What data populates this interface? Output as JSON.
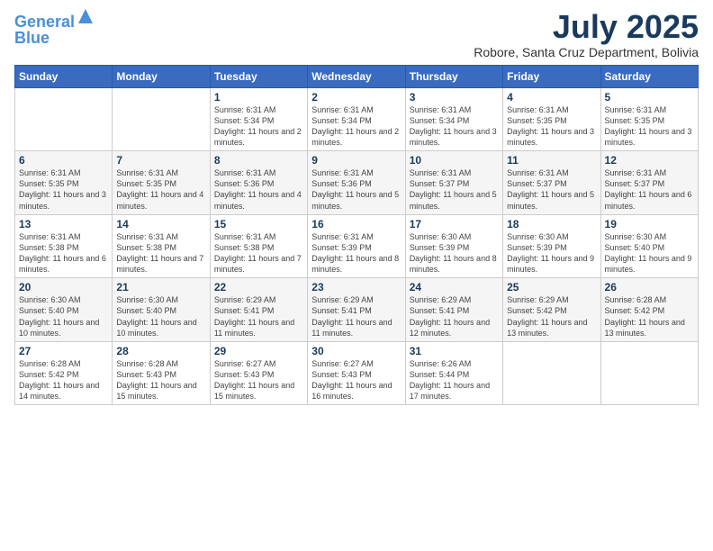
{
  "header": {
    "logo_line1": "General",
    "logo_line2": "Blue",
    "month_title": "July 2025",
    "location": "Robore, Santa Cruz Department, Bolivia"
  },
  "weekdays": [
    "Sunday",
    "Monday",
    "Tuesday",
    "Wednesday",
    "Thursday",
    "Friday",
    "Saturday"
  ],
  "weeks": [
    [
      {
        "day": "",
        "info": ""
      },
      {
        "day": "",
        "info": ""
      },
      {
        "day": "1",
        "info": "Sunrise: 6:31 AM\nSunset: 5:34 PM\nDaylight: 11 hours and 2 minutes."
      },
      {
        "day": "2",
        "info": "Sunrise: 6:31 AM\nSunset: 5:34 PM\nDaylight: 11 hours and 2 minutes."
      },
      {
        "day": "3",
        "info": "Sunrise: 6:31 AM\nSunset: 5:34 PM\nDaylight: 11 hours and 3 minutes."
      },
      {
        "day": "4",
        "info": "Sunrise: 6:31 AM\nSunset: 5:35 PM\nDaylight: 11 hours and 3 minutes."
      },
      {
        "day": "5",
        "info": "Sunrise: 6:31 AM\nSunset: 5:35 PM\nDaylight: 11 hours and 3 minutes."
      }
    ],
    [
      {
        "day": "6",
        "info": "Sunrise: 6:31 AM\nSunset: 5:35 PM\nDaylight: 11 hours and 3 minutes."
      },
      {
        "day": "7",
        "info": "Sunrise: 6:31 AM\nSunset: 5:35 PM\nDaylight: 11 hours and 4 minutes."
      },
      {
        "day": "8",
        "info": "Sunrise: 6:31 AM\nSunset: 5:36 PM\nDaylight: 11 hours and 4 minutes."
      },
      {
        "day": "9",
        "info": "Sunrise: 6:31 AM\nSunset: 5:36 PM\nDaylight: 11 hours and 5 minutes."
      },
      {
        "day": "10",
        "info": "Sunrise: 6:31 AM\nSunset: 5:37 PM\nDaylight: 11 hours and 5 minutes."
      },
      {
        "day": "11",
        "info": "Sunrise: 6:31 AM\nSunset: 5:37 PM\nDaylight: 11 hours and 5 minutes."
      },
      {
        "day": "12",
        "info": "Sunrise: 6:31 AM\nSunset: 5:37 PM\nDaylight: 11 hours and 6 minutes."
      }
    ],
    [
      {
        "day": "13",
        "info": "Sunrise: 6:31 AM\nSunset: 5:38 PM\nDaylight: 11 hours and 6 minutes."
      },
      {
        "day": "14",
        "info": "Sunrise: 6:31 AM\nSunset: 5:38 PM\nDaylight: 11 hours and 7 minutes."
      },
      {
        "day": "15",
        "info": "Sunrise: 6:31 AM\nSunset: 5:38 PM\nDaylight: 11 hours and 7 minutes."
      },
      {
        "day": "16",
        "info": "Sunrise: 6:31 AM\nSunset: 5:39 PM\nDaylight: 11 hours and 8 minutes."
      },
      {
        "day": "17",
        "info": "Sunrise: 6:30 AM\nSunset: 5:39 PM\nDaylight: 11 hours and 8 minutes."
      },
      {
        "day": "18",
        "info": "Sunrise: 6:30 AM\nSunset: 5:39 PM\nDaylight: 11 hours and 9 minutes."
      },
      {
        "day": "19",
        "info": "Sunrise: 6:30 AM\nSunset: 5:40 PM\nDaylight: 11 hours and 9 minutes."
      }
    ],
    [
      {
        "day": "20",
        "info": "Sunrise: 6:30 AM\nSunset: 5:40 PM\nDaylight: 11 hours and 10 minutes."
      },
      {
        "day": "21",
        "info": "Sunrise: 6:30 AM\nSunset: 5:40 PM\nDaylight: 11 hours and 10 minutes."
      },
      {
        "day": "22",
        "info": "Sunrise: 6:29 AM\nSunset: 5:41 PM\nDaylight: 11 hours and 11 minutes."
      },
      {
        "day": "23",
        "info": "Sunrise: 6:29 AM\nSunset: 5:41 PM\nDaylight: 11 hours and 11 minutes."
      },
      {
        "day": "24",
        "info": "Sunrise: 6:29 AM\nSunset: 5:41 PM\nDaylight: 11 hours and 12 minutes."
      },
      {
        "day": "25",
        "info": "Sunrise: 6:29 AM\nSunset: 5:42 PM\nDaylight: 11 hours and 13 minutes."
      },
      {
        "day": "26",
        "info": "Sunrise: 6:28 AM\nSunset: 5:42 PM\nDaylight: 11 hours and 13 minutes."
      }
    ],
    [
      {
        "day": "27",
        "info": "Sunrise: 6:28 AM\nSunset: 5:42 PM\nDaylight: 11 hours and 14 minutes."
      },
      {
        "day": "28",
        "info": "Sunrise: 6:28 AM\nSunset: 5:43 PM\nDaylight: 11 hours and 15 minutes."
      },
      {
        "day": "29",
        "info": "Sunrise: 6:27 AM\nSunset: 5:43 PM\nDaylight: 11 hours and 15 minutes."
      },
      {
        "day": "30",
        "info": "Sunrise: 6:27 AM\nSunset: 5:43 PM\nDaylight: 11 hours and 16 minutes."
      },
      {
        "day": "31",
        "info": "Sunrise: 6:26 AM\nSunset: 5:44 PM\nDaylight: 11 hours and 17 minutes."
      },
      {
        "day": "",
        "info": ""
      },
      {
        "day": "",
        "info": ""
      }
    ]
  ]
}
